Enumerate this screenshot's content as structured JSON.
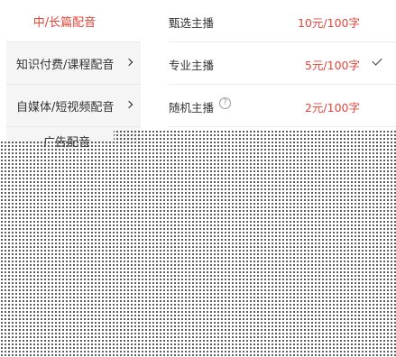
{
  "categories": [
    {
      "label": "中/长篇配音",
      "active": true,
      "has_chevron": false
    },
    {
      "label": "知识付费/课程配音",
      "active": false,
      "has_chevron": true
    },
    {
      "label": "自媒体/短视频配音",
      "active": false,
      "has_chevron": true
    },
    {
      "label": "广告配音",
      "active": false,
      "has_chevron": false
    }
  ],
  "options": [
    {
      "name": "甄选主播",
      "price": "10元/100字",
      "help": false,
      "selected": false
    },
    {
      "name": "专业主播",
      "price": "5元/100字",
      "help": false,
      "selected": true
    },
    {
      "name": "随机主播",
      "price": "2元/100字",
      "help": true,
      "selected": false
    }
  ],
  "help_glyph": "?",
  "overlay": "dotted-mask",
  "colors": {
    "accent": "#e0463a",
    "menu_bg": "#f5f5f5"
  }
}
